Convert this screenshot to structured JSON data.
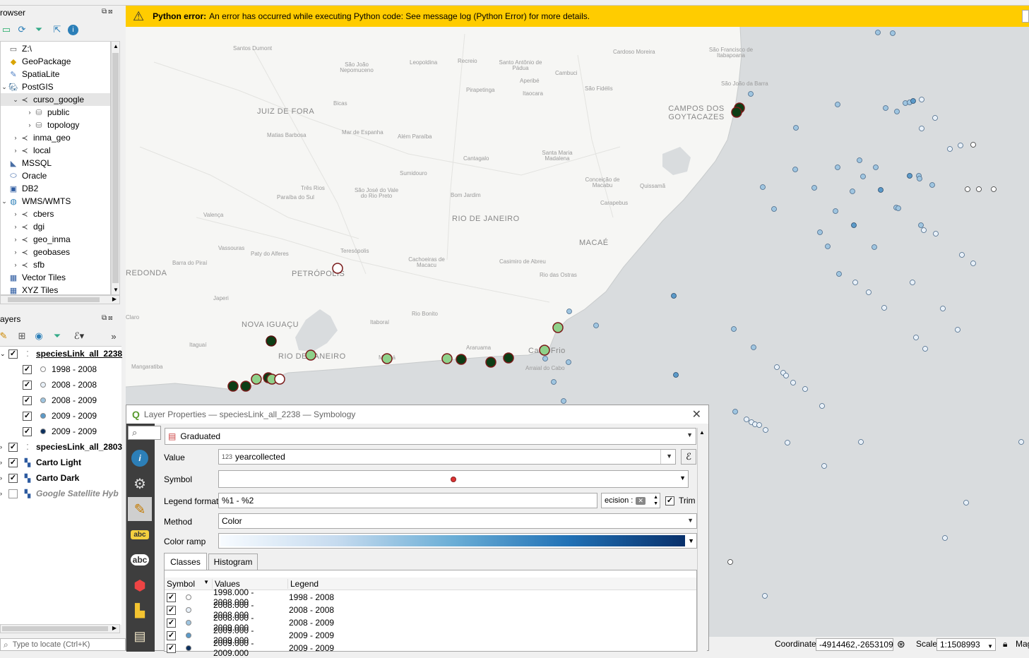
{
  "browser": {
    "title": "rowser",
    "items": [
      {
        "label": "Z:\\",
        "icon": "folder-icon",
        "depth": 0,
        "arrow": ""
      },
      {
        "label": "GeoPackage",
        "icon": "geopackage-icon",
        "depth": 0,
        "arrow": ""
      },
      {
        "label": "SpatiaLite",
        "icon": "spatialite-icon",
        "depth": 0,
        "arrow": ""
      },
      {
        "label": "PostGIS",
        "icon": "postgis-icon",
        "depth": 0,
        "arrow": "v"
      },
      {
        "label": "curso_google",
        "icon": "connection-icon",
        "depth": 1,
        "arrow": "v"
      },
      {
        "label": "public",
        "icon": "schema-icon",
        "depth": 2,
        "arrow": ">"
      },
      {
        "label": "topology",
        "icon": "schema-icon",
        "depth": 2,
        "arrow": ">"
      },
      {
        "label": "inma_geo",
        "icon": "connection-icon",
        "depth": 1,
        "arrow": ">"
      },
      {
        "label": "local",
        "icon": "connection-icon",
        "depth": 1,
        "arrow": ">"
      },
      {
        "label": "MSSQL",
        "icon": "mssql-icon",
        "depth": 0,
        "arrow": ""
      },
      {
        "label": "Oracle",
        "icon": "oracle-icon",
        "depth": 0,
        "arrow": ""
      },
      {
        "label": "DB2",
        "icon": "db2-icon",
        "depth": 0,
        "arrow": ""
      },
      {
        "label": "WMS/WMTS",
        "icon": "globe-icon",
        "depth": 0,
        "arrow": "v"
      },
      {
        "label": "cbers",
        "icon": "connection-icon",
        "depth": 1,
        "arrow": ">"
      },
      {
        "label": "dgi",
        "icon": "connection-icon",
        "depth": 1,
        "arrow": ">"
      },
      {
        "label": "geo_inma",
        "icon": "connection-icon",
        "depth": 1,
        "arrow": ">"
      },
      {
        "label": "geobases",
        "icon": "connection-icon",
        "depth": 1,
        "arrow": ">"
      },
      {
        "label": "sfb",
        "icon": "connection-icon",
        "depth": 1,
        "arrow": ">"
      },
      {
        "label": "Vector Tiles",
        "icon": "grid-icon",
        "depth": 0,
        "arrow": ""
      },
      {
        "label": "XYZ Tiles",
        "icon": "grid-icon",
        "depth": 0,
        "arrow": ""
      }
    ]
  },
  "layers": {
    "title": "ayers",
    "items": [
      {
        "label": "speciesLink_all_2238",
        "checked": true,
        "bold": true,
        "underline": true,
        "type": "layer"
      },
      {
        "label": "1998 - 2008",
        "checked": true,
        "type": "class",
        "dot": "#ffffff"
      },
      {
        "label": "2008 - 2008",
        "checked": true,
        "type": "class",
        "dot": "#e8f0f8"
      },
      {
        "label": "2008 - 2009",
        "checked": true,
        "type": "class",
        "dot": "#9fc5e0"
      },
      {
        "label": "2009 - 2009",
        "checked": true,
        "type": "class",
        "dot": "#5b9ac9"
      },
      {
        "label": "2009 - 2009",
        "checked": true,
        "type": "class",
        "dot": "#0b2f5e"
      },
      {
        "label": "speciesLink_all_2803",
        "checked": true,
        "bold": true,
        "type": "layer"
      },
      {
        "label": "Carto Light",
        "checked": true,
        "bold": true,
        "type": "raster"
      },
      {
        "label": "Carto Dark",
        "checked": true,
        "bold": true,
        "type": "raster"
      },
      {
        "label": "Google Satellite Hyb",
        "checked": false,
        "italic": true,
        "type": "raster"
      }
    ]
  },
  "locator": {
    "placeholder": "Type to locate (Ctrl+K)"
  },
  "message_bar": {
    "title": "Python error:",
    "text": "An error has occurred while executing Python code: See message log (Python Error) for more details."
  },
  "map_labels": [
    {
      "t": "Cataguases"
    },
    {
      "t": "Miracema"
    },
    {
      "t": "Italva"
    },
    {
      "t": "Santos Dumont"
    },
    {
      "t": "São João Nepomuceno"
    },
    {
      "t": "Leopoldina"
    },
    {
      "t": "Recreio"
    },
    {
      "t": "Santo Antônio de Pádua"
    },
    {
      "t": "Cardoso Moreira"
    },
    {
      "t": "São Francisco de Itabapoana"
    },
    {
      "t": "Cambuci"
    },
    {
      "t": "Aperibé"
    },
    {
      "t": "Pirapetinga"
    },
    {
      "t": "Itaocara"
    },
    {
      "t": "São Fidélis"
    },
    {
      "t": "São João da Barra"
    },
    {
      "t": "Bicas"
    },
    {
      "t": "JUIZ DE FORA"
    },
    {
      "t": "CAMPOS DOS GOYTACAZES"
    },
    {
      "t": "Matias Barbosa"
    },
    {
      "t": "Mar de Espanha"
    },
    {
      "t": "Além Paraíba"
    },
    {
      "t": "Cantagalo"
    },
    {
      "t": "Santa Maria Madalena"
    },
    {
      "t": "Sumidouro"
    },
    {
      "t": "Conceição de Macabu"
    },
    {
      "t": "Três Rios"
    },
    {
      "t": "Paraíba do Sul"
    },
    {
      "t": "São José do Vale do Rio Preto"
    },
    {
      "t": "Bom Jardim"
    },
    {
      "t": "Quissamã"
    },
    {
      "t": "Carapebus"
    },
    {
      "t": "Valença"
    },
    {
      "t": "RIO DE JANEIRO"
    },
    {
      "t": "Vassouras"
    },
    {
      "t": "Paty do Alferes"
    },
    {
      "t": "Teresópolis"
    },
    {
      "t": "MACAÉ"
    },
    {
      "t": "Barra do Piraí"
    },
    {
      "t": "Cachoeiras de Macacu"
    },
    {
      "t": "Casimiro de Abreu"
    },
    {
      "t": "REDONDA"
    },
    {
      "t": "PETRÓPOLIS"
    },
    {
      "t": "Rio das Ostras"
    },
    {
      "t": "Japeri"
    },
    {
      "t": "Rio Bonito"
    },
    {
      "t": "Itaboraí"
    },
    {
      "t": "Claro"
    },
    {
      "t": "NOVA IGUAÇU"
    },
    {
      "t": "Itaguaí"
    },
    {
      "t": "RIO DE JANEIRO"
    },
    {
      "t": "Maricá"
    },
    {
      "t": "Araruama"
    },
    {
      "t": "Cabo Frio"
    },
    {
      "t": "Arraial do Cabo"
    },
    {
      "t": "Mangaratiba"
    }
  ],
  "dialog": {
    "title": "Layer Properties — speciesLink_all_2238 — Symbology",
    "renderer": "Graduated",
    "value_label": "Value",
    "value_prefix": "123",
    "value": "yearcollected",
    "symbol_label": "Symbol",
    "legend_format_label": "Legend format",
    "legend_format": "%1 - %2",
    "precision": "ecision :",
    "trim_label": "Trim",
    "method_label": "Method",
    "method": "Color",
    "color_ramp_label": "Color ramp",
    "tabs": [
      "Classes",
      "Histogram"
    ],
    "columns": [
      "Symbol",
      "Values",
      "Legend"
    ],
    "rows": [
      {
        "values": "1998.000 - 2008.000",
        "legend": "1998 - 2008",
        "dot": "#ffffff"
      },
      {
        "values": "2008.000 - 2008.000",
        "legend": "2008 - 2008",
        "dot": "#e8f0f8"
      },
      {
        "values": "2008.000 - 2009.000",
        "legend": "2008 - 2009",
        "dot": "#9fc5e0"
      },
      {
        "values": "2009.000 - 2009.000",
        "legend": "2009 - 2009",
        "dot": "#5b9ac9"
      },
      {
        "values": "2009.000 - 2009.000",
        "legend": "2009 - 2009",
        "dot": "#0b2f5e"
      }
    ]
  },
  "status": {
    "coordinate_label": "Coordinate",
    "coordinate": "-4914462,-2653109",
    "scale_label": "Scale",
    "scale": "1:1508993",
    "magnifier_label": "Mag"
  }
}
